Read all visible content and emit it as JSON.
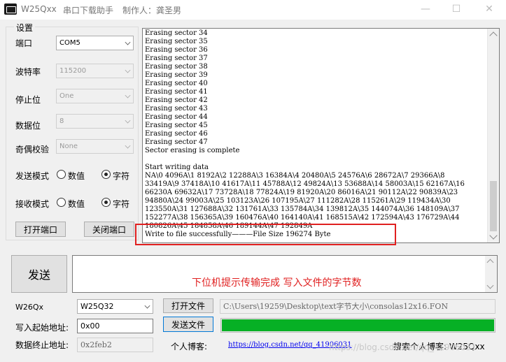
{
  "window": {
    "app_name": "W25Qxx",
    "subtitle": "串口下载助手",
    "author": "制作人：龚圣男",
    "minimize_glyph": "—",
    "maximize_glyph": "☐",
    "close_glyph": "✕"
  },
  "settings": {
    "group_title": "设置",
    "port_label": "端口",
    "port_value": "COM5",
    "baud_label": "波特率",
    "baud_value": "115200",
    "stopbit_label": "停止位",
    "stopbit_value": "One",
    "databit_label": "数据位",
    "databit_value": "8",
    "parity_label": "奇偶校验",
    "parity_value": "None",
    "send_mode_label": "发送模式",
    "recv_mode_label": "接收模式",
    "option_hex": "数值",
    "option_char": "字符",
    "open_port": "打开端口",
    "close_port": "关闭端口"
  },
  "log": {
    "lines": [
      "Erasing sector 34",
      "Erasing sector 35",
      "Erasing sector 36",
      "Erasing sector 37",
      "Erasing sector 38",
      "Erasing sector 39",
      "Erasing sector 40",
      "Erasing sector 41",
      "Erasing sector 42",
      "Erasing sector 43",
      "Erasing sector 44",
      "Erasing sector 45",
      "Erasing sector 46",
      "Erasing sector 47",
      "Sector erasing is complete",
      "",
      "Start writing data",
      "NA\\0 4096A\\1 8192A\\2 12288A\\3 16384A\\4 20480A\\5 24576A\\6 28672A\\7 29366A\\8",
      "33419A\\9 37418A\\10 41617A\\11 45788A\\12 49824A\\13 53688A\\14 58003A\\15 62167A\\16",
      "66230A 69632A\\17 73728A\\18 77824A\\19 81920A\\20 86016A\\21 90112A\\22 90839A\\23",
      "94880A\\24 99003A\\25 103123A\\26 107195A\\27 111282A\\28 115261A\\29 119434A\\30",
      "123550A\\31 127688A\\32 131761A\\33 135784A\\34 139812A\\35 144074A\\36 148109A\\37",
      "152277A\\38 156365A\\39 160476A\\40 164140A\\41 168515A\\42 172594A\\43 176729A\\44",
      "180826A\\45 184858A\\46 189144A\\47 192849A",
      "Write to file successfully———File Size 196274 Byte"
    ]
  },
  "send": {
    "button": "发送",
    "annotation": "下位机提示传输完成  写入文件的字节数"
  },
  "bottom": {
    "chip_label": "W26Qx",
    "chip_value": "W25Q32",
    "open_file": "打开文件",
    "file_path": "C:\\Users\\19259\\Desktop\\text字节大小\\consolas12x16.FON",
    "start_addr_label": "写入起始地址:",
    "start_addr_value": "0x00",
    "send_file": "发送文件",
    "progress_fraction": 1.0,
    "end_addr_label": "数据终止地址:",
    "end_addr_value": "0x2feb2",
    "blog_label": "个人博客:",
    "blog_link": "https://blog.csdn.net/qq_41906031",
    "search_blog": "搜索个人博客: W25Qxx",
    "watermark": "https://blog.csdn.net/qq_41906031"
  }
}
